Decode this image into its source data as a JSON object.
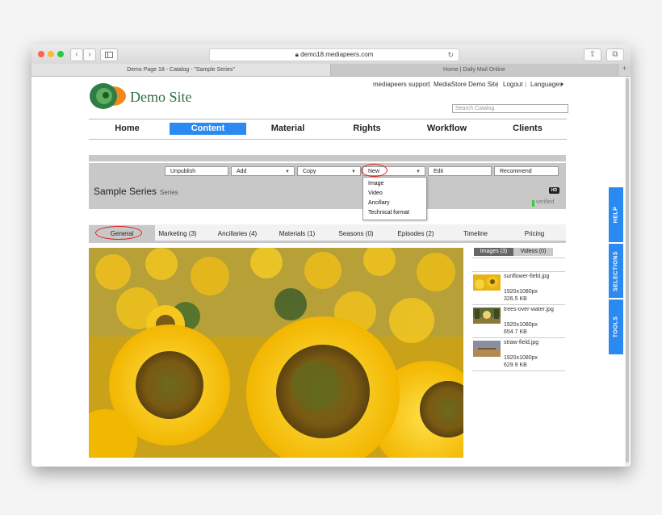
{
  "browser": {
    "url": "demo18.mediapeers.com",
    "tabs": [
      "Demo Page 18 - Catalog - \"Sample Series\"",
      "Home | Daily Mail Online"
    ]
  },
  "site": {
    "logo_text": "Demo Site",
    "top_links": [
      "mediapeers support",
      "MediaStore Demo Site",
      "Logout",
      "Languages"
    ],
    "search_placeholder": "Search Catalog",
    "accent": "#2b8af2"
  },
  "nav": [
    "Home",
    "Content",
    "Material",
    "Rights",
    "Workflow",
    "Clients"
  ],
  "toolbar": {
    "unpublish": "Unpublish",
    "add": "Add",
    "copy": "Copy",
    "new": "New",
    "edit": "Edit",
    "recommend": "Recommend"
  },
  "new_menu": [
    "Image",
    "Video",
    "Ancillary",
    "Technical format"
  ],
  "item": {
    "title": "Sample Series",
    "type": "Series",
    "badge": "HD",
    "status": "verified"
  },
  "section_tabs": [
    "General",
    "Marketing (3)",
    "Ancillaries (4)",
    "Materials (1)",
    "Seasons (0)",
    "Episodes (2)",
    "Timeline",
    "Pricing"
  ],
  "media_tabs": [
    "Images (3)",
    "Videos (0)"
  ],
  "images": [
    {
      "name": "sunflower-field.jpg",
      "dims": "1920x1080px",
      "size": "326.5 KB"
    },
    {
      "name": "trees-over-water.jpg",
      "dims": "1920x1080px",
      "size": "654.7 KB"
    },
    {
      "name": "straw-field.jpg",
      "dims": "1920x1080px",
      "size": "629.9 KB"
    }
  ],
  "side_tabs": [
    "HELP",
    "SELECTIONS",
    "TOOLS"
  ]
}
